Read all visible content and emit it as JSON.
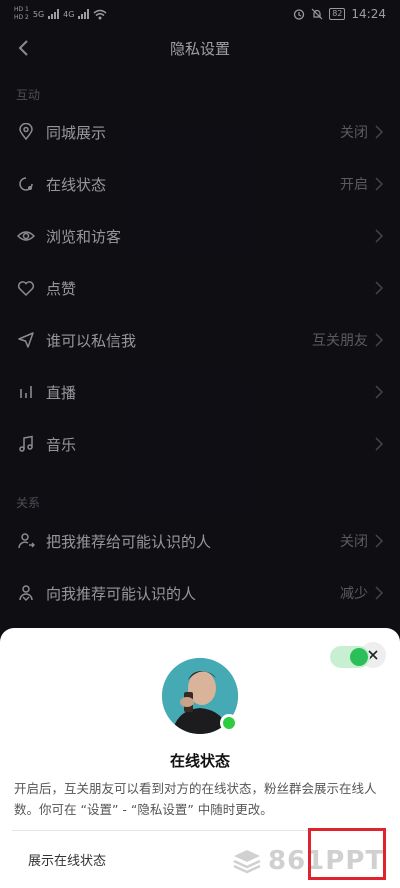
{
  "status_bar": {
    "hd1": "HD 1",
    "hd2": "HD 2",
    "net1": "5G",
    "net2": "4G",
    "battery": "82",
    "time": "14:24"
  },
  "nav": {
    "title": "隐私设置"
  },
  "sections": {
    "interaction": "互动",
    "relations": "关系"
  },
  "rows": [
    {
      "label": "同城展示",
      "value": "关闭",
      "icon": "location-icon"
    },
    {
      "label": "在线状态",
      "value": "开启",
      "icon": "online-status-icon"
    },
    {
      "label": "浏览和访客",
      "value": "",
      "icon": "eye-icon"
    },
    {
      "label": "点赞",
      "value": "",
      "icon": "heart-icon"
    },
    {
      "label": "谁可以私信我",
      "value": "互关朋友",
      "icon": "send-icon"
    },
    {
      "label": "直播",
      "value": "",
      "icon": "live-bars-icon"
    },
    {
      "label": "音乐",
      "value": "",
      "icon": "music-note-icon"
    },
    {
      "label": "把我推荐给可能认识的人",
      "value": "关闭",
      "icon": "recommend-me-icon"
    },
    {
      "label": "向我推荐可能认识的人",
      "value": "减少",
      "icon": "recommend-to-me-icon"
    }
  ],
  "sheet": {
    "title": "在线状态",
    "description": "开启后，互关朋友可以看到对方的在线状态，粉丝群会展示在线人数。你可在 “设置” - “隐私设置” 中随时更改。",
    "toggle_label": "展示在线状态",
    "toggle_on": true
  },
  "watermark": "861PPT",
  "colors": {
    "background": "#16161e",
    "online_green": "#2ecc40",
    "highlight_red": "#e0242f"
  }
}
